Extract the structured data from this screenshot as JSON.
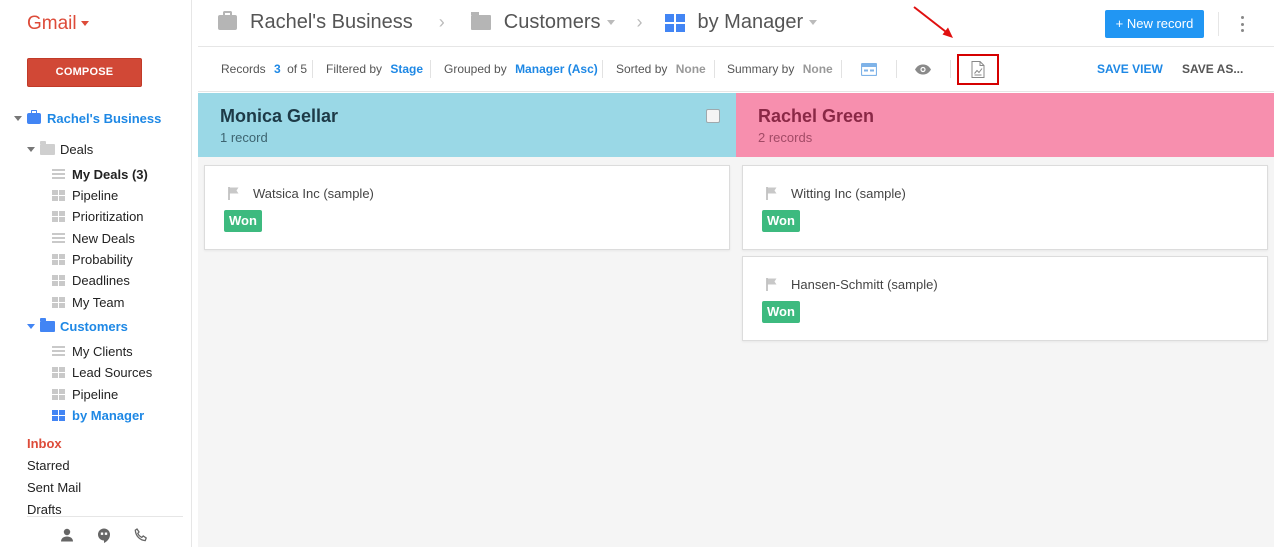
{
  "sidebar": {
    "app_name": "Gmail",
    "compose_label": "COMPOSE",
    "business": "Rachel's Business",
    "deals_folder": "Deals",
    "deals_views": [
      "My Deals (3)",
      "Pipeline",
      "Prioritization",
      "New Deals",
      "Probability",
      "Deadlines",
      "My Team"
    ],
    "customers_folder": "Customers",
    "customers_views": [
      "My Clients",
      "Lead Sources",
      "Pipeline",
      "by Manager"
    ],
    "mail_links": [
      "Inbox",
      "Starred",
      "Sent Mail",
      "Drafts"
    ],
    "footer_icons": [
      "person-icon",
      "hangouts-icon",
      "phone-icon"
    ]
  },
  "topbar": {
    "breadcrumb": [
      "Rachel's Business",
      "Customers",
      "by Manager"
    ],
    "new_record_label": "+ New record"
  },
  "toolbar": {
    "records_label": "Records",
    "records_current": "3",
    "records_total": "of 5",
    "filtered_label": "Filtered by",
    "filtered_value": "Stage",
    "grouped_label": "Grouped by",
    "grouped_value": "Manager (Asc)",
    "sorted_label": "Sorted by",
    "sorted_value": "None",
    "summary_label": "Summary by",
    "summary_value": "None",
    "save_view": "SAVE VIEW",
    "save_as": "SAVE AS..."
  },
  "board": {
    "columns": [
      {
        "title": "Monica Gellar",
        "count": "1 record",
        "color": "#9ad8e6",
        "cards": [
          {
            "name": "Watsica Inc (sample)",
            "stage": "Won"
          }
        ]
      },
      {
        "title": "Rachel Green",
        "count": "2 records",
        "color": "#f78fae",
        "cards": [
          {
            "name": "Witting Inc (sample)",
            "stage": "Won"
          },
          {
            "name": "Hansen-Schmitt (sample)",
            "stage": "Won"
          }
        ]
      }
    ]
  },
  "colors": {
    "gmail_red": "#dd4b39",
    "accent_blue": "#1e88e5",
    "won_green": "#3dba7f",
    "highlight_red": "#d50000"
  }
}
